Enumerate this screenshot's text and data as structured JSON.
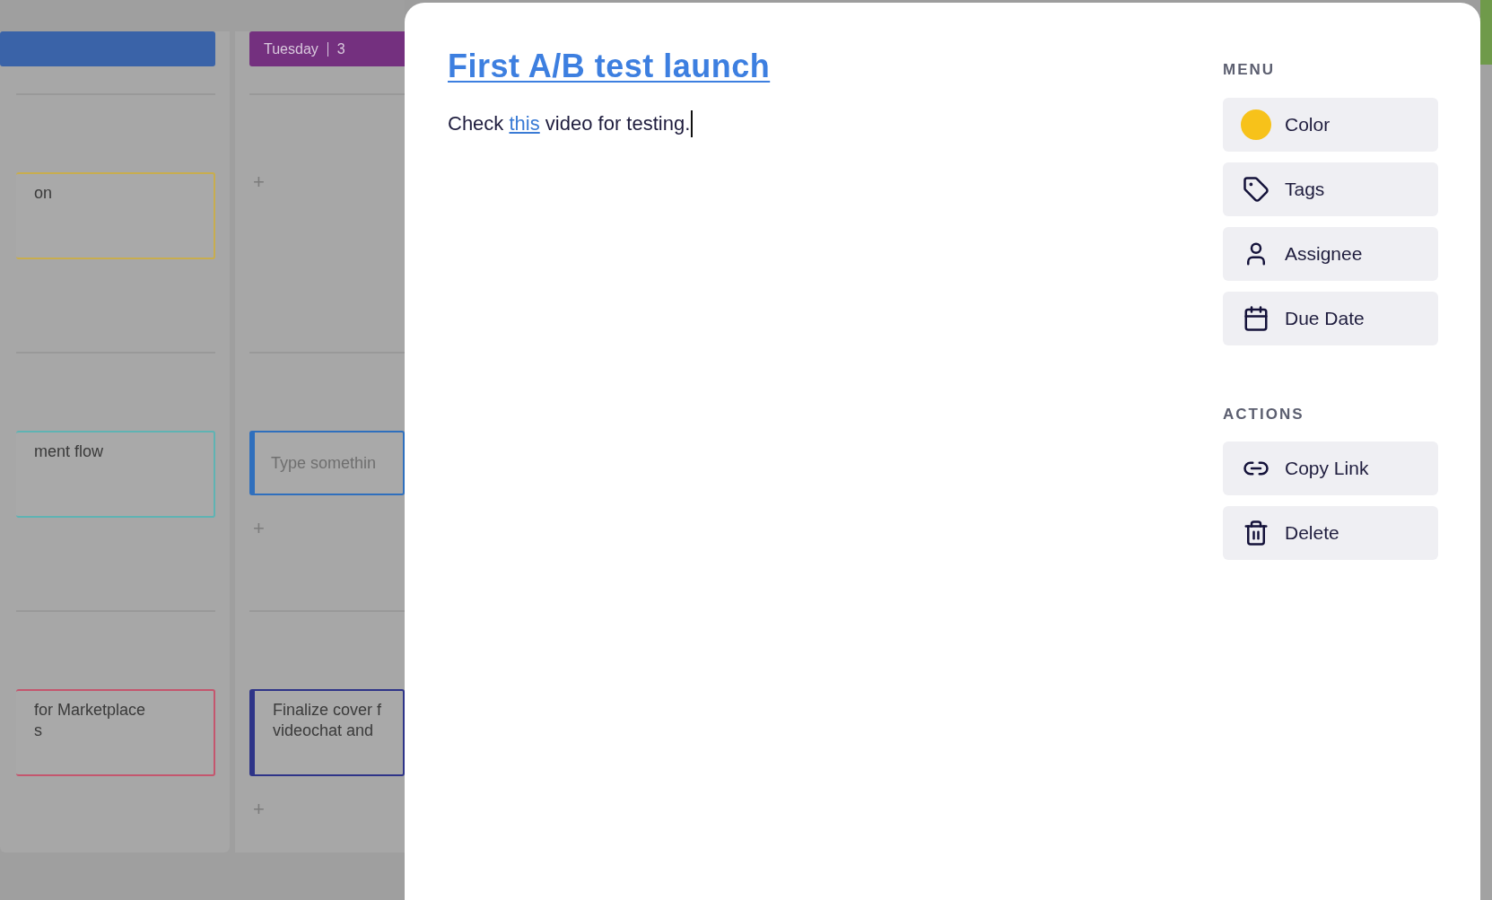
{
  "board": {
    "columns": [
      {
        "color": "#3a63a8",
        "sections": [
          [
            {
              "kind": "card",
              "lines": [
                "on"
              ],
              "color": "#c8ad4e"
            }
          ],
          [
            {
              "kind": "card",
              "lines": [
                "ment flow"
              ],
              "color": "#5fb3b3"
            }
          ],
          [
            {
              "kind": "card",
              "lines": [
                "for Marketplace",
                "s"
              ],
              "color": "#c4566e"
            }
          ]
        ]
      },
      {
        "color": "#74307f",
        "header": "Tuesday",
        "count": "3",
        "sections": [
          [
            {
              "kind": "add",
              "label": "+"
            }
          ],
          [
            {
              "kind": "input",
              "placeholder": "Type somethin",
              "color": "#2f6fbd"
            },
            {
              "kind": "add",
              "label": "+"
            }
          ],
          [
            {
              "kind": "card",
              "lines": [
                "Finalize cover f",
                "videochat and"
              ],
              "color": "#2e3488",
              "accent": true
            },
            {
              "kind": "add",
              "label": "+"
            }
          ]
        ]
      }
    ]
  },
  "note": {
    "title": "First A/B test launch",
    "body": {
      "before": "Check ",
      "link": "this",
      "after": " video for testing."
    }
  },
  "menu": {
    "label": "MENU",
    "items": [
      {
        "kind": "dot",
        "label": "Color",
        "color": "#f7c21a"
      },
      {
        "kind": "tag",
        "label": "Tags"
      },
      {
        "kind": "person",
        "label": "Assignee"
      },
      {
        "kind": "calendar",
        "label": "Due Date"
      }
    ]
  },
  "actions": {
    "label": "ACTIONS",
    "items": [
      {
        "kind": "link",
        "label": "Copy Link"
      },
      {
        "kind": "trash",
        "label": "Delete"
      }
    ]
  }
}
